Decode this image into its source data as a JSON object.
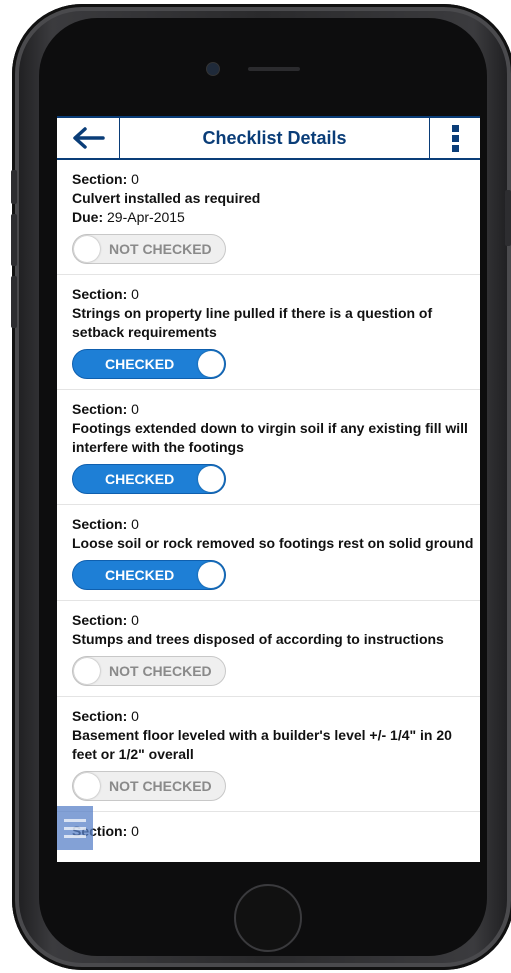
{
  "header": {
    "title": "Checklist Details",
    "back_icon": "arrow-left-icon",
    "menu_icon": "kebab-menu-icon"
  },
  "labels": {
    "section": "Section:",
    "due": "Due:"
  },
  "items": [
    {
      "section": "0",
      "description": "Culvert installed as required",
      "due": "29-Apr-2015",
      "status": "NOT CHECKED",
      "checked": false
    },
    {
      "section": "0",
      "description": "Strings on property line pulled if there is a question of setback requirements",
      "status": "CHECKED",
      "checked": true
    },
    {
      "section": "0",
      "description": "Footings extended down to virgin soil if any existing fill will interfere with the footings",
      "status": "CHECKED",
      "checked": true
    },
    {
      "section": "0",
      "description": "Loose soil or rock removed so footings rest on solid ground",
      "status": "CHECKED",
      "checked": true
    },
    {
      "section": "0",
      "description": "Stumps and trees disposed of according to instructions",
      "status": "NOT CHECKED",
      "checked": false
    },
    {
      "section": "0",
      "description": "Basement floor leveled with a builder's level +/- 1/4\" in 20 feet or 1/2\" overall",
      "status": "NOT CHECKED",
      "checked": false
    },
    {
      "section": "0"
    }
  ],
  "colors": {
    "header_blue": "#0a3d78",
    "toggle_on": "#1e7fd6",
    "toggle_off": "#efefef"
  },
  "fab_icon": "hamburger-menu-icon"
}
